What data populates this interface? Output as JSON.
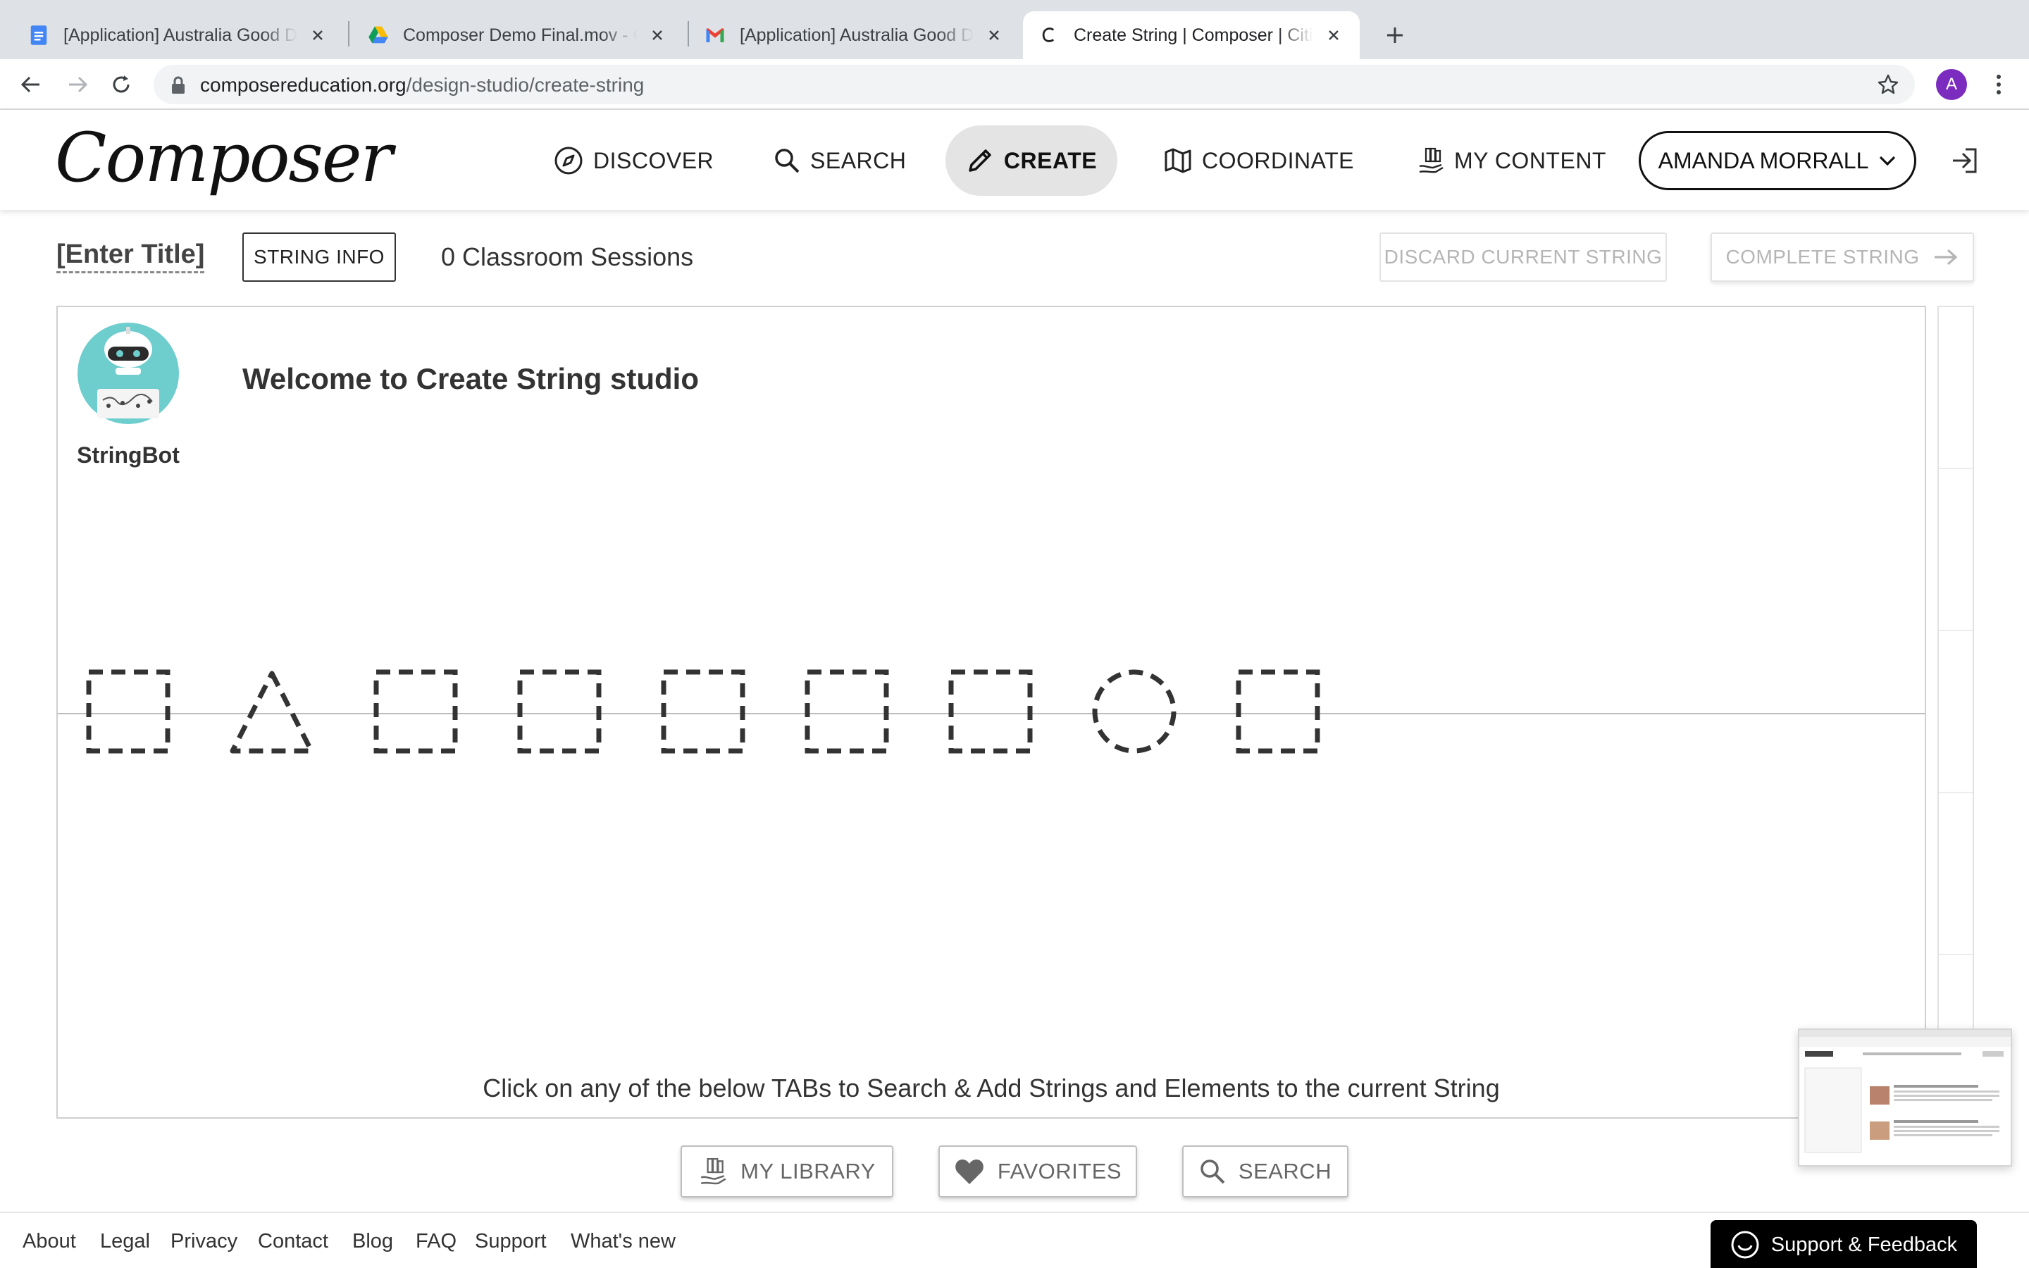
{
  "browser": {
    "tabs": [
      {
        "title": "[Application] Australia Good De",
        "icon": "google-docs-icon"
      },
      {
        "title": "Composer Demo Final.mov - Go",
        "icon": "google-drive-icon"
      },
      {
        "title": "[Application] Australia Good De",
        "icon": "gmail-icon"
      },
      {
        "title": "Create String | Composer | Citiz",
        "icon": "composer-c-icon"
      }
    ],
    "url_domain": "composereducation.org",
    "url_path": "/design-studio/create-string",
    "profile_initial": "A"
  },
  "header": {
    "logo": "Composer",
    "nav": {
      "discover": "DISCOVER",
      "search": "SEARCH",
      "create": "CREATE",
      "coordinate": "COORDINATE",
      "my_content": "MY CONTENT"
    },
    "user": "AMANDA MORRALL"
  },
  "titlebar": {
    "enter_title": "[Enter Title]",
    "string_info": "STRING INFO",
    "sessions": "0 Classroom Sessions",
    "discard": "DISCARD CURRENT STRING",
    "complete": "COMPLETE STRING"
  },
  "studio": {
    "bot_name": "StringBot",
    "welcome": "Welcome to Create String studio",
    "slots": [
      "square",
      "triangle",
      "square",
      "square",
      "square",
      "square",
      "square",
      "circle",
      "square"
    ],
    "hint": "Click on any of the below TABs to Search & Add Strings and Elements to the current String"
  },
  "bottom_tabs": {
    "library": "MY LIBRARY",
    "favorites": "FAVORITES",
    "search": "SEARCH"
  },
  "footer": {
    "links": [
      "About",
      "Legal",
      "Privacy",
      "Contact",
      "Blog",
      "FAQ",
      "Support",
      "What's new"
    ],
    "support": "Support & Feedback"
  },
  "colors": {
    "create_pill": "#e4e4e4",
    "profile": "#7b2cbf",
    "bot_teal": "#6ecdcd",
    "disabled_text": "#b5b5b5"
  }
}
